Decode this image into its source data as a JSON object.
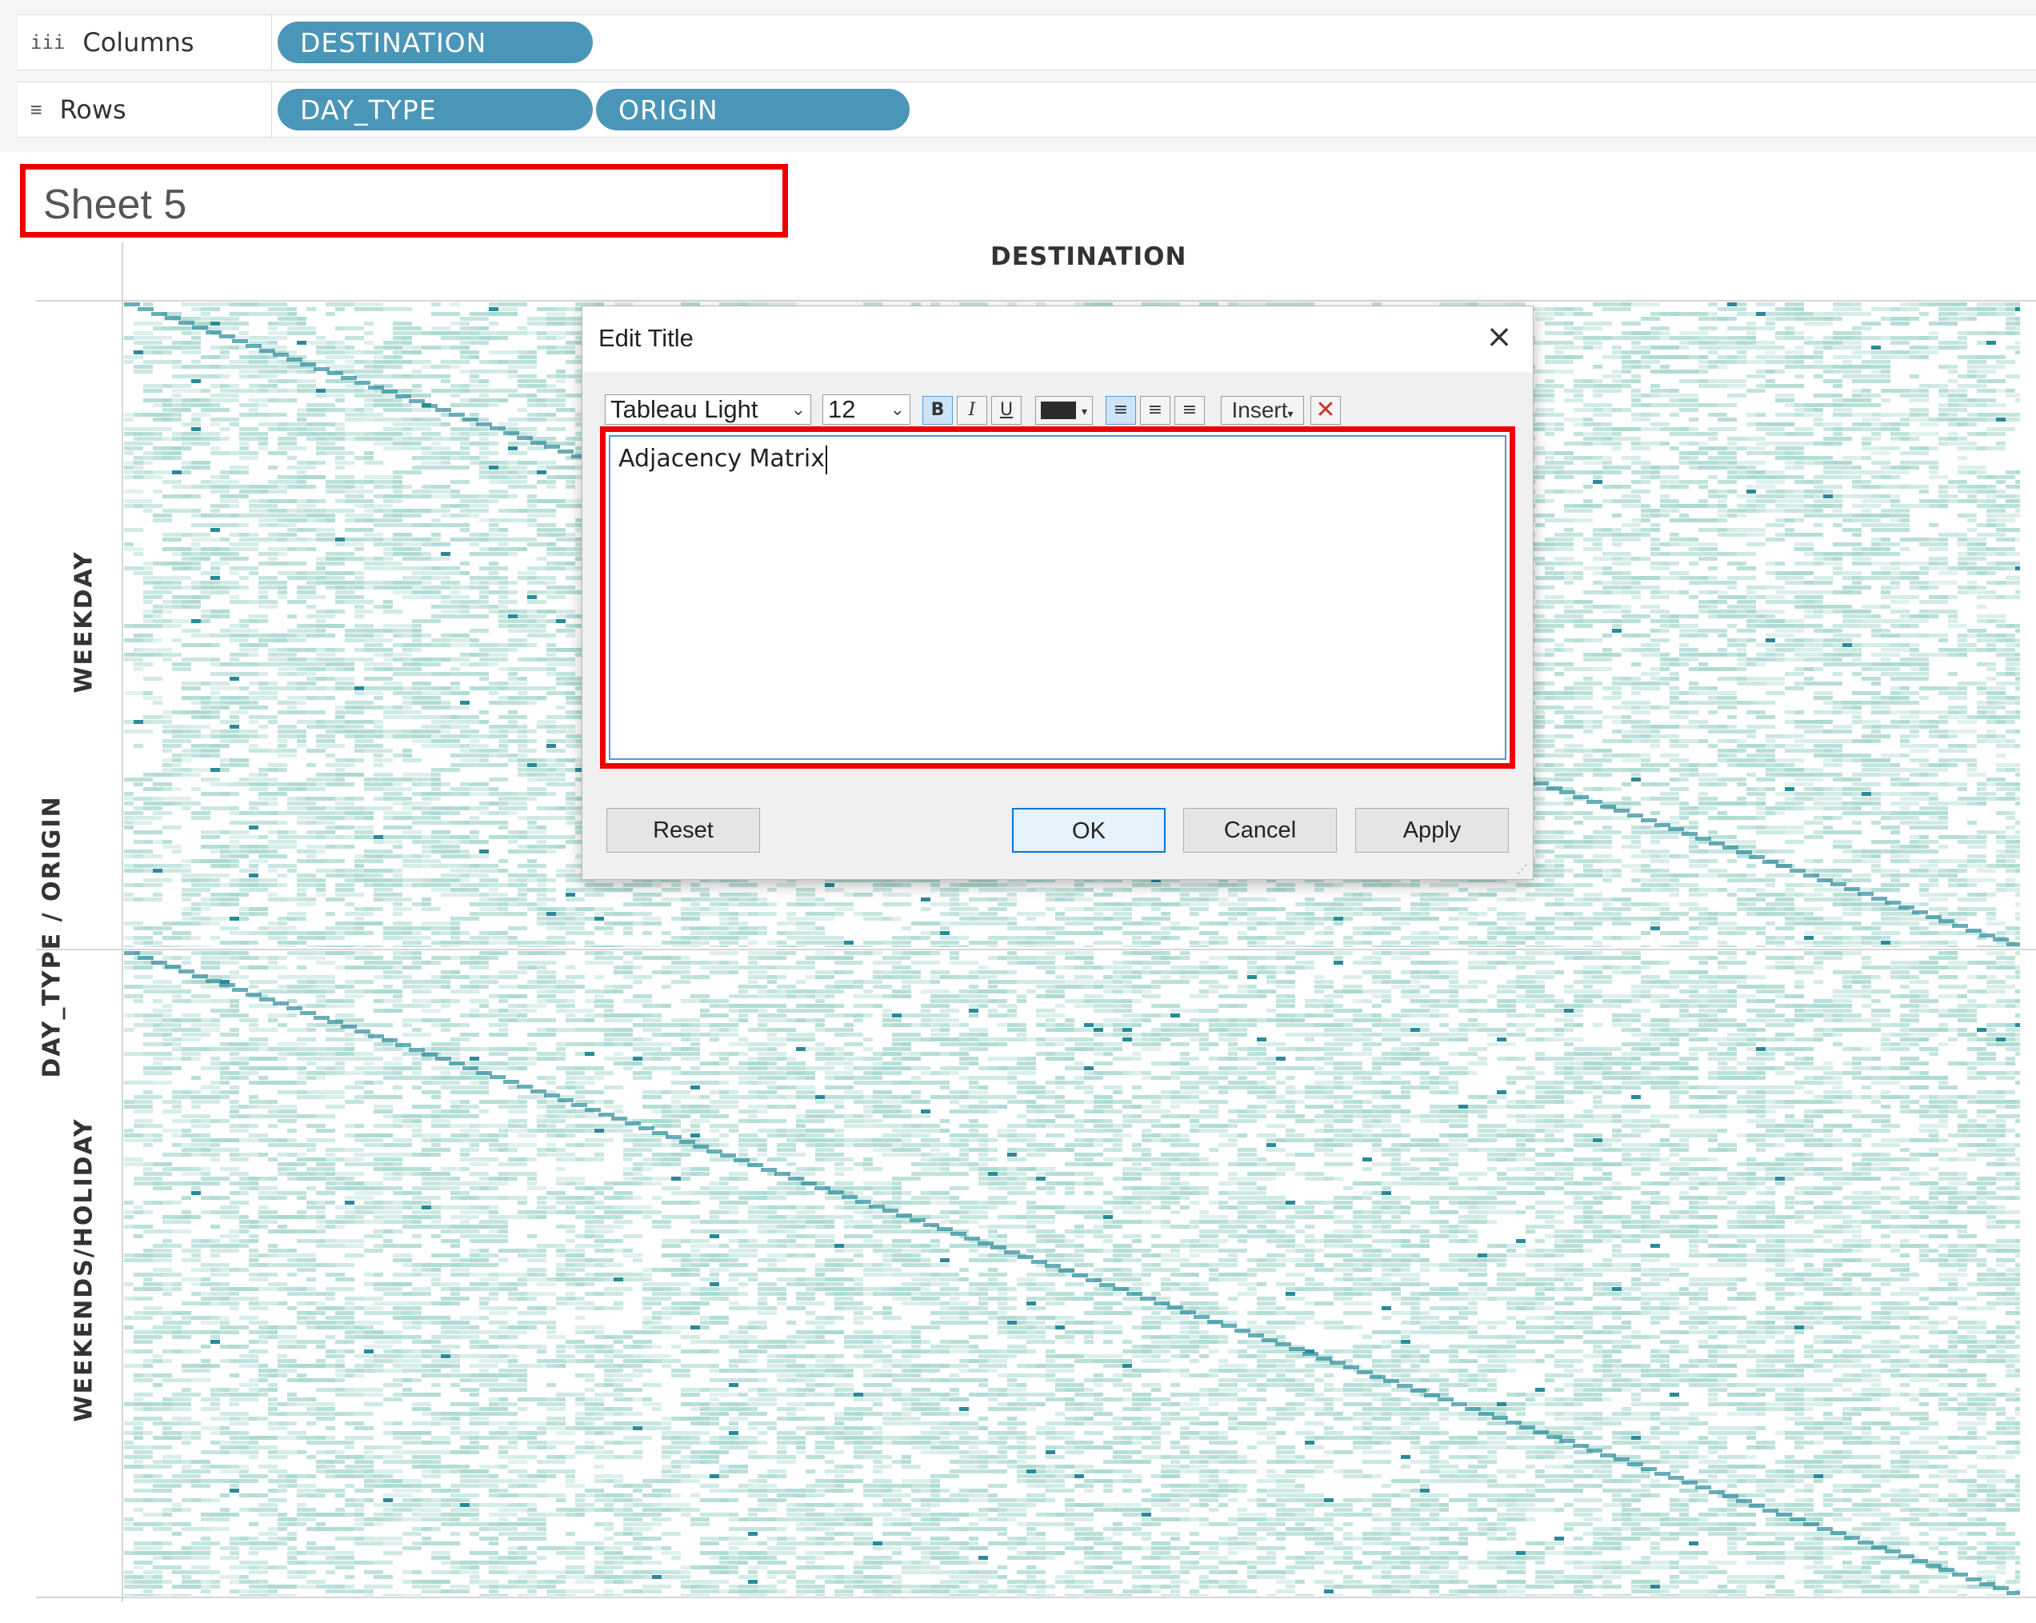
{
  "shelves": {
    "columns": {
      "label": "Columns",
      "icon": "columns-icon",
      "pills": [
        "DESTINATION"
      ]
    },
    "rows": {
      "label": "Rows",
      "icon": "rows-icon",
      "pills": [
        "DAY_TYPE",
        "ORIGIN"
      ]
    }
  },
  "sheet": {
    "title": "Sheet 5"
  },
  "view": {
    "column_header": "DESTINATION",
    "row_axis_label": "DAY_TYPE / ORIGIN",
    "row_groups": [
      "WEEKDAY",
      "WEEKENDS/HOLIDAY"
    ],
    "mark_color_light": "#a8d8cf",
    "mark_color_dark": "#2a8a9a"
  },
  "dialog": {
    "title": "Edit Title",
    "font": "Tableau Light",
    "size": "12",
    "bold": "B",
    "italic": "I",
    "underline": "U",
    "insert": "Insert",
    "text": "Adjacency Matrix",
    "buttons": {
      "reset": "Reset",
      "ok": "OK",
      "cancel": "Cancel",
      "apply": "Apply"
    }
  },
  "colors": {
    "pill": "#4a96b8",
    "highlight": "#ee0000",
    "accent": "#0078d7"
  }
}
